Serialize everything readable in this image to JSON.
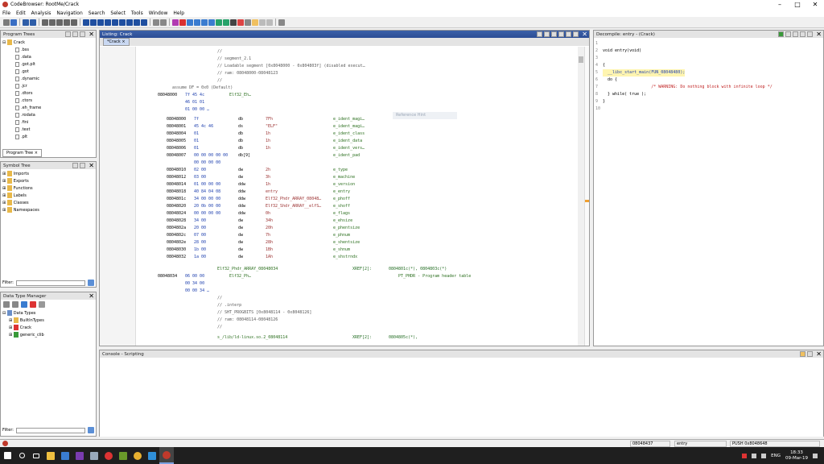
{
  "window": {
    "title": "CodeBrowser: RootMe/Crack"
  },
  "menu": [
    "File",
    "Edit",
    "Analysis",
    "Navigation",
    "Search",
    "Select",
    "Tools",
    "Window",
    "Help"
  ],
  "program_trees": {
    "title": "Program Trees",
    "root": "Crack",
    "items": [
      ".bss",
      ".data",
      ".got.plt",
      ".got",
      ".dynamic",
      ".jcr",
      ".dtors",
      ".ctors",
      ".eh_frame",
      ".rodata",
      ".fini",
      ".text",
      ".plt"
    ],
    "tab": "Program Tree"
  },
  "symbol_tree": {
    "title": "Symbol Tree",
    "items": [
      "Imports",
      "Exports",
      "Functions",
      "Labels",
      "Classes",
      "Namespaces"
    ],
    "filter_label": "Filter:"
  },
  "data_type_manager": {
    "title": "Data Type Manager",
    "root": "Data Types",
    "items": [
      "BuiltInTypes",
      "Crack",
      "generic_clib"
    ],
    "filter_label": "Filter:"
  },
  "listing": {
    "title": "Listing: Crack",
    "tab": "Crack",
    "hint": "Reference Hint",
    "header_lines": [
      "//",
      "// segment_2.1",
      "// Loadable segment  [0x8048000 - 0x804803f] (disabled execut…",
      "// ram: 08048000-08048123",
      "//"
    ],
    "assume": "assume DF = 0x0  (Default)",
    "elf_line": {
      "addr": "08048000",
      "bytes": "7f 45 4c",
      "label": "Elf32_Eh…"
    },
    "elf_cont": [
      "46 01 01",
      "01 00 00 …"
    ],
    "rows": [
      {
        "addr": "08048000",
        "bytes": "7f",
        "mn": "db",
        "op": "7Fh",
        "field": "e_ident_magi…"
      },
      {
        "addr": "08048001",
        "bytes": "45 4c 46",
        "mn": "ds",
        "op": "\"ELF\"",
        "field": "e_ident_magi…"
      },
      {
        "addr": "08048004",
        "bytes": "01",
        "mn": "db",
        "op": "1h",
        "field": "e_ident_class"
      },
      {
        "addr": "08048005",
        "bytes": "01",
        "mn": "db",
        "op": "1h",
        "field": "e_ident_data"
      },
      {
        "addr": "08048006",
        "bytes": "01",
        "mn": "db",
        "op": "1h",
        "field": "e_ident_vers…"
      },
      {
        "addr": "08048007",
        "bytes": "00 00 00 00 00",
        "mn": "db[9]",
        "op": "",
        "field": "e_ident_pad"
      },
      {
        "addr": "",
        "bytes": "00 00 00 00",
        "mn": "",
        "op": "",
        "field": ""
      },
      {
        "addr": "08048010",
        "bytes": "02 00",
        "mn": "dw",
        "op": "2h",
        "field": "e_type"
      },
      {
        "addr": "08048012",
        "bytes": "03 00",
        "mn": "dw",
        "op": "3h",
        "field": "e_machine"
      },
      {
        "addr": "08048014",
        "bytes": "01 00 00 00",
        "mn": "ddw",
        "op": "1h",
        "field": "e_version"
      },
      {
        "addr": "08048018",
        "bytes": "40 84 04 08",
        "mn": "ddw",
        "op": "entry",
        "field": "e_entry"
      },
      {
        "addr": "0804801c",
        "bytes": "34 00 00 00",
        "mn": "ddw",
        "op": "Elf32_Phdr_ARRAY_08048…",
        "field": "e_phoff"
      },
      {
        "addr": "08048020",
        "bytes": "20 0b 00 00",
        "mn": "ddw",
        "op": "Elf32_Shdr_ARRAY__elfS…",
        "field": "e_shoff"
      },
      {
        "addr": "08048024",
        "bytes": "00 00 00 00",
        "mn": "ddw",
        "op": "0h",
        "field": "e_flags"
      },
      {
        "addr": "08048028",
        "bytes": "34 00",
        "mn": "dw",
        "op": "34h",
        "field": "e_ehsize"
      },
      {
        "addr": "0804802a",
        "bytes": "20 00",
        "mn": "dw",
        "op": "20h",
        "field": "e_phentsize"
      },
      {
        "addr": "0804802c",
        "bytes": "07 00",
        "mn": "dw",
        "op": "7h",
        "field": "e_phnum"
      },
      {
        "addr": "0804802e",
        "bytes": "28 00",
        "mn": "dw",
        "op": "28h",
        "field": "e_shentsize"
      },
      {
        "addr": "08048030",
        "bytes": "1b 00",
        "mn": "dw",
        "op": "1Bh",
        "field": "e_shnum"
      },
      {
        "addr": "08048032",
        "bytes": "1a 00",
        "mn": "dw",
        "op": "1Ah",
        "field": "e_shstrndx"
      }
    ],
    "phdr_label": "Elf32_Phdr_ARRAY_08048034",
    "phdr_xref_label": "XREF[2]:",
    "phdr_xref": "0804801c(*), 0804803c(*)",
    "phdr_line": {
      "addr": "08048034",
      "bytes": "06 00 00",
      "label": "Elf32_Ph…",
      "field": "PT_PHDR - Program header table"
    },
    "phdr_cont": [
      "00 34 00",
      "00 00 34 …"
    ],
    "interp_lines": [
      "//",
      "// .interp",
      "// SHT_PROGBITS  [0x8048114 - 0x8048126]",
      "// ram: 08048114-08048126",
      "//"
    ],
    "last_line": "s_/lib/ld-linux.so.2_08048114",
    "last_xref_label": "XREF[2]:",
    "last_xref": "0804805c(*),"
  },
  "decompiler": {
    "title": "Decompile: entry - (Crack)",
    "lines": [
      {
        "n": "1",
        "code": ""
      },
      {
        "n": "2",
        "code": "void entry(void)"
      },
      {
        "n": "3",
        "code": ""
      },
      {
        "n": "4",
        "code": "{"
      },
      {
        "n": "5",
        "code": "  __libc_start_main(FUN_08048480);"
      },
      {
        "n": "6",
        "code": "  do {"
      },
      {
        "n": "7",
        "code": "                    /* WARNING: Do nothing block with infinite loop */"
      },
      {
        "n": "8",
        "code": "  } while( true );"
      },
      {
        "n": "9",
        "code": "}"
      },
      {
        "n": "10",
        "code": ""
      }
    ]
  },
  "console": {
    "title": "Console - Scripting"
  },
  "status": {
    "address": "08048437",
    "function": "entry",
    "instruction": "PUSH 0x8048648"
  },
  "taskbar": {
    "time": "18:33",
    "date": "09-Mar-19",
    "lang": "ENG"
  }
}
